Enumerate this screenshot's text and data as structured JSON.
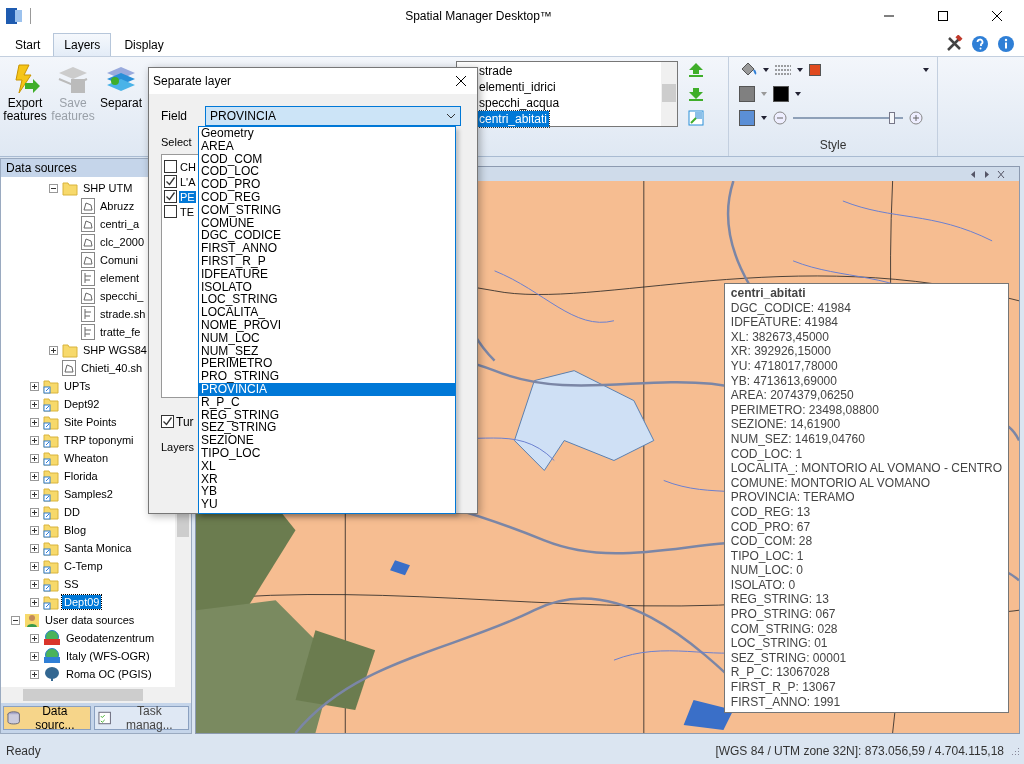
{
  "window": {
    "title": "Spatial Manager Desktop™"
  },
  "tabs": [
    {
      "label": "Start",
      "selected": false
    },
    {
      "label": "Layers",
      "selected": true
    },
    {
      "label": "Display",
      "selected": false
    }
  ],
  "ribbon": {
    "buttons": [
      {
        "label": "Export features",
        "kind": "export",
        "disabled": false
      },
      {
        "label": "Save features",
        "kind": "save",
        "disabled": true
      },
      {
        "label": "Separat",
        "kind": "separate",
        "disabled": false
      }
    ],
    "layers": [
      {
        "name": "strade",
        "selected": false
      },
      {
        "name": "elementi_idrici",
        "selected": false
      },
      {
        "name": "specchi_acqua",
        "selected": false
      },
      {
        "name": "centri_abitati",
        "selected": true
      }
    ],
    "style_group": {
      "label": "Style",
      "opacity": {
        "level": 0.9
      }
    }
  },
  "data_sources": {
    "title": "Data sources",
    "tree": [
      {
        "children": [
          {
            "children": [
              {
                "label": "SHP UTM",
                "kind": "folder",
                "expanded": true,
                "selected": false,
                "children": [
                  {
                    "label": "Abruzz",
                    "kind": "polygon-file",
                    "selected": false
                  },
                  {
                    "label": "centri_a",
                    "kind": "polygon-file",
                    "selected": false
                  },
                  {
                    "label": "clc_2000",
                    "kind": "polygon-file",
                    "selected": false
                  },
                  {
                    "label": "Comuni",
                    "kind": "polygon-file",
                    "selected": false
                  },
                  {
                    "label": "element",
                    "kind": "line-file",
                    "selected": false
                  },
                  {
                    "label": "specchi_",
                    "kind": "polygon-file",
                    "selected": false
                  },
                  {
                    "label": "strade.sh",
                    "kind": "line-file",
                    "selected": false
                  },
                  {
                    "label": "tratte_fe",
                    "kind": "line-file",
                    "selected": false
                  }
                ]
              },
              {
                "label": "SHP WGS84",
                "kind": "folder",
                "expanded": false,
                "selected": false
              },
              {
                "label": "Chieti_40.sh",
                "kind": "polygon-file",
                "selected": false
              }
            ]
          },
          {
            "label": "UPTs",
            "kind": "linked-folder",
            "expanded": false,
            "selected": false
          },
          {
            "label": "Dept92",
            "kind": "linked-folder",
            "expanded": false,
            "selected": false
          },
          {
            "label": "Site Points",
            "kind": "linked-folder",
            "expanded": false,
            "selected": false
          },
          {
            "label": "TRP toponymi",
            "kind": "linked-folder",
            "expanded": false,
            "selected": false
          },
          {
            "label": "Wheaton",
            "kind": "linked-folder",
            "expanded": false,
            "selected": false
          },
          {
            "label": "Florida",
            "kind": "linked-folder",
            "expanded": false,
            "selected": false
          },
          {
            "label": "Samples2",
            "kind": "linked-folder",
            "expanded": false,
            "selected": false
          },
          {
            "label": "DD",
            "kind": "linked-folder",
            "expanded": false,
            "selected": false
          },
          {
            "label": "Blog",
            "kind": "linked-folder",
            "expanded": false,
            "selected": false
          },
          {
            "label": "Santa Monica",
            "kind": "linked-folder",
            "expanded": false,
            "selected": false
          },
          {
            "label": "C-Temp",
            "kind": "linked-folder",
            "expanded": false,
            "selected": false
          },
          {
            "label": "SS",
            "kind": "linked-folder",
            "expanded": false,
            "selected": false
          },
          {
            "label": "Dept09",
            "kind": "linked-folder",
            "expanded": false,
            "selected": true
          }
        ]
      },
      {
        "label": "User data sources",
        "kind": "user",
        "expanded": true,
        "selected": false,
        "children": [
          {
            "label": "Geodatenzentrum",
            "kind": "wfs",
            "expanded": false,
            "selected": false
          },
          {
            "label": "Italy (WFS-OGR)",
            "kind": "ogr",
            "expanded": false,
            "selected": false
          },
          {
            "label": "Roma OC (PGIS)",
            "kind": "pgis",
            "expanded": false,
            "selected": false
          }
        ]
      }
    ],
    "tabs": [
      {
        "label": "Data sourc...",
        "selected": true
      },
      {
        "label": "Task manag...",
        "selected": false
      }
    ]
  },
  "map": {
    "info": {
      "title": "centri_abitati",
      "lines": [
        "DGC_CODICE: 41984",
        "IDFEATURE: 41984",
        "XL: 382673,45000",
        "XR: 392926,15000",
        "YU: 4718017,78000",
        "YB: 4713613,69000",
        "AREA: 2074379,06250",
        "PERIMETRO: 23498,08800",
        "SEZIONE: 14,61900",
        "NUM_SEZ: 14619,04760",
        "COD_LOC: 1",
        "LOCALITA_: MONTORIO AL VOMANO - CENTRO",
        "COMUNE: MONTORIO AL VOMANO",
        "PROVINCIA: TERAMO",
        "COD_REG: 13",
        "COD_PRO: 67",
        "COD_COM: 28",
        "TIPO_LOC: 1",
        "NUM_LOC: 0",
        "ISOLATO: 0",
        "REG_STRING: 13",
        "PRO_STRING: 067",
        "COM_STRING: 028",
        "LOC_STRING: 01",
        "SEZ_STRING: 00001",
        "R_P_C: 13067028",
        "FIRST_R_P: 13067",
        "FIRST_ANNO: 1991"
      ]
    }
  },
  "dialog": {
    "title": "Separate layer",
    "field_label": "Field",
    "field_value": "PROVINCIA",
    "select_label": "Select",
    "values": [
      {
        "label": "CH",
        "checked": false,
        "selected": false
      },
      {
        "label": "L'A",
        "checked": true,
        "selected": false
      },
      {
        "label": "PE",
        "checked": true,
        "selected": true
      },
      {
        "label": "TE",
        "checked": false,
        "selected": false
      }
    ],
    "turn_option": {
      "label": "Tur",
      "checked": true
    },
    "layers_label": "Layers",
    "field_options": [
      {
        "label": "Geometry",
        "selected": false
      },
      {
        "label": "AREA",
        "selected": false
      },
      {
        "label": "COD_COM",
        "selected": false
      },
      {
        "label": "COD_LOC",
        "selected": false
      },
      {
        "label": "COD_PRO",
        "selected": false
      },
      {
        "label": "COD_REG",
        "selected": false
      },
      {
        "label": "COM_STRING",
        "selected": false
      },
      {
        "label": "COMUNE",
        "selected": false
      },
      {
        "label": "DGC_CODICE",
        "selected": false
      },
      {
        "label": "FIRST_ANNO",
        "selected": false
      },
      {
        "label": "FIRST_R_P",
        "selected": false
      },
      {
        "label": "IDFEATURE",
        "selected": false
      },
      {
        "label": "ISOLATO",
        "selected": false
      },
      {
        "label": "LOC_STRING",
        "selected": false
      },
      {
        "label": "LOCALITA_",
        "selected": false
      },
      {
        "label": "NOME_PROVI",
        "selected": false
      },
      {
        "label": "NUM_LOC",
        "selected": false
      },
      {
        "label": "NUM_SEZ",
        "selected": false
      },
      {
        "label": "PERIMETRO",
        "selected": false
      },
      {
        "label": "PRO_STRING",
        "selected": false
      },
      {
        "label": "PROVINCIA",
        "selected": true
      },
      {
        "label": "R_P_C",
        "selected": false
      },
      {
        "label": "REG_STRING",
        "selected": false
      },
      {
        "label": "SEZ_STRING",
        "selected": false
      },
      {
        "label": "SEZIONE",
        "selected": false
      },
      {
        "label": "TIPO_LOC",
        "selected": false
      },
      {
        "label": "XL",
        "selected": false
      },
      {
        "label": "XR",
        "selected": false
      },
      {
        "label": "YB",
        "selected": false
      },
      {
        "label": "YU",
        "selected": false
      }
    ]
  },
  "status_bar": {
    "left": "Ready",
    "right": "[WGS 84 / UTM zone 32N]: 873.056,59 / 4.704.115,18"
  }
}
